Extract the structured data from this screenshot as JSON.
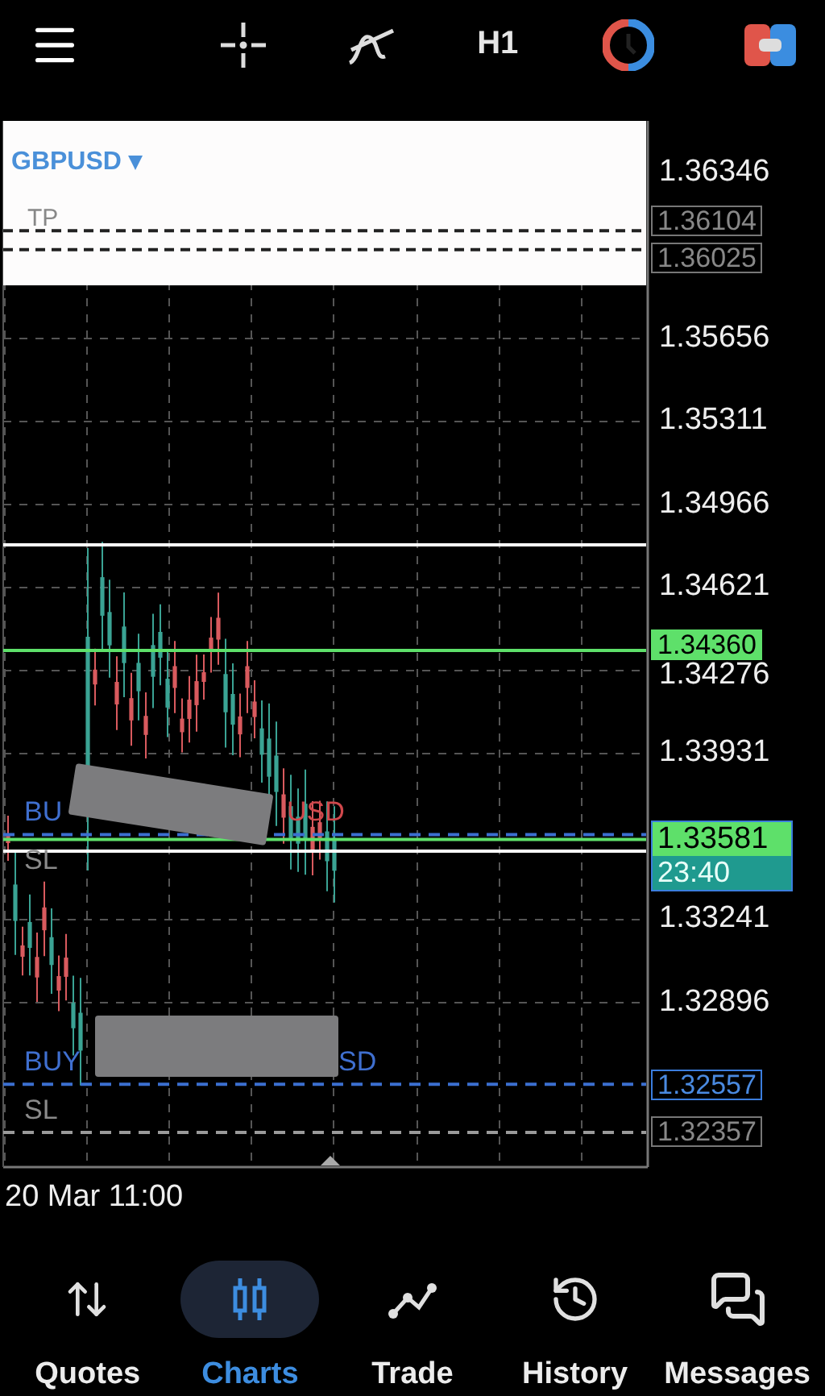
{
  "toolbar": {
    "timeframe": "H1"
  },
  "chart": {
    "symbol": "GBPUSD",
    "symbol_caret": "▾",
    "tp_label": "TP",
    "price_ticks": [
      "1.36346",
      "1.35656",
      "1.35311",
      "1.34966",
      "1.34621",
      "1.34276",
      "1.33931",
      "1.33241",
      "1.32896"
    ],
    "levels": [
      {
        "kind": "tp",
        "price": "1.36104"
      },
      {
        "kind": "tp",
        "price": "1.36025"
      },
      {
        "kind": "alert",
        "price": "1.34360"
      },
      {
        "kind": "entry",
        "price": "1.32557"
      },
      {
        "kind": "sl",
        "price": "1.32357"
      }
    ],
    "bid": {
      "price": "1.33581",
      "countdown": "23:40"
    },
    "order_labels": [
      {
        "kind": "buy",
        "text": "BU"
      },
      {
        "kind": "sell",
        "text": "USD"
      },
      {
        "kind": "sl",
        "text": "SL"
      },
      {
        "kind": "buy",
        "text": "BUY"
      },
      {
        "kind": "buy",
        "text": "SD"
      },
      {
        "kind": "sl",
        "text": "SL"
      }
    ],
    "time_label": "20 Mar 11:00"
  },
  "nav": [
    {
      "label": "Quotes",
      "selected": false
    },
    {
      "label": "Charts",
      "selected": true
    },
    {
      "label": "Trade",
      "selected": false
    },
    {
      "label": "History",
      "selected": false
    },
    {
      "label": "Messages",
      "selected": false
    }
  ]
}
